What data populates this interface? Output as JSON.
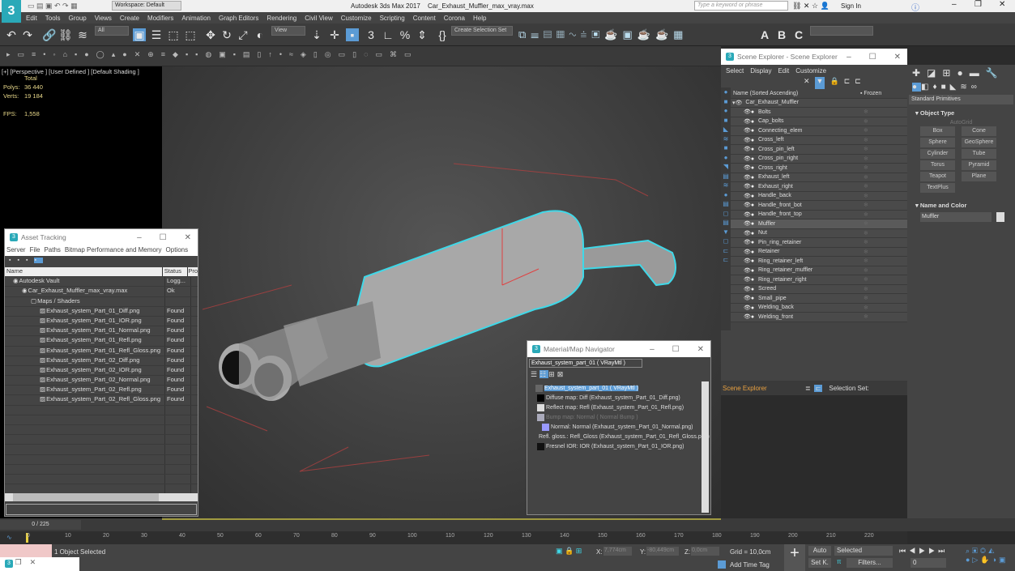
{
  "app": {
    "title": "Autodesk 3ds Max 2017",
    "file": "Car_Exhaust_Muffler_max_vray.max",
    "workspace": "Workspace: Default",
    "search_placeholder": "Type a keyword or phrase",
    "sign_in": "Sign In"
  },
  "menu": [
    "Edit",
    "Tools",
    "Group",
    "Views",
    "Create",
    "Modifiers",
    "Animation",
    "Graph Editors",
    "Rendering",
    "Civil View",
    "Customize",
    "Scripting",
    "Content",
    "Corona",
    "Help"
  ],
  "toolbar": {
    "filter": "All",
    "refcoord": "View",
    "selection_set": "Create Selection Set"
  },
  "viewport": {
    "label": "[+] [Perspective ] [User Defined ] [Default Shading ]",
    "stats_header": "Total",
    "polys_label": "Polys:",
    "polys": "36 440",
    "verts_label": "Verts:",
    "verts": "19 184",
    "fps_label": "FPS:",
    "fps": "1,558"
  },
  "scene_explorer": {
    "title": "Scene Explorer - Scene Explorer",
    "menu": [
      "Select",
      "Display",
      "Edit",
      "Customize"
    ],
    "col_name": "Name (Sorted Ascending)",
    "col_frozen": "▪ Frozen",
    "root": "Car_Exhaust_Muffler",
    "items": [
      "Bolts",
      "Cap_bolts",
      "Connecting_elem",
      "Cross_left",
      "Cross_pin_left",
      "Cross_pin_right",
      "Cross_right",
      "Exhaust_left",
      "Exhaust_right",
      "Handle_back",
      "Handle_front_bot",
      "Handle_front_top",
      "Muffler",
      "Nut",
      "Pin_ring_retainer",
      "Retainer",
      "Ring_retainer_left",
      "Ring_retainer_muffler",
      "Ring_retainer_right",
      "Screed",
      "Small_pipe",
      "Welding_back",
      "Welding_front"
    ],
    "selected": "Muffler",
    "footer": "Scene Explorer",
    "selection_set_label": "Selection Set:"
  },
  "command_panel": {
    "dropdown": "Standard Primitives",
    "object_type": "Object Type",
    "autogrid": "AutoGrid",
    "buttons": [
      "Box",
      "Cone",
      "Sphere",
      "GeoSphere",
      "Cylinder",
      "Tube",
      "Torus",
      "Pyramid",
      "Teapot",
      "Plane",
      "TextPlus"
    ],
    "name_color": "Name and Color",
    "object_name": "Muffler"
  },
  "asset_tracking": {
    "title": "Asset Tracking",
    "menu": [
      "Server",
      "File",
      "Paths",
      "Bitmap Performance and Memory",
      "Options"
    ],
    "col_name": "Name",
    "col_status": "Status",
    "col_pro": "Pro",
    "rows": [
      {
        "name": "Autodesk Vault",
        "status": "Logg...",
        "level": 0
      },
      {
        "name": "Car_Exhaust_Muffler_max_vray.max",
        "status": "Ok",
        "level": 1
      },
      {
        "name": "Maps / Shaders",
        "status": "",
        "level": 2
      },
      {
        "name": "Exhaust_system_Part_01_Diff.png",
        "status": "Found",
        "level": 3
      },
      {
        "name": "Exhaust_system_Part_01_IOR.png",
        "status": "Found",
        "level": 3
      },
      {
        "name": "Exhaust_system_Part_01_Normal.png",
        "status": "Found",
        "level": 3
      },
      {
        "name": "Exhaust_system_Part_01_Refl.png",
        "status": "Found",
        "level": 3
      },
      {
        "name": "Exhaust_system_Part_01_Refl_Gloss.png",
        "status": "Found",
        "level": 3
      },
      {
        "name": "Exhaust_system_Part_02_Diff.png",
        "status": "Found",
        "level": 3
      },
      {
        "name": "Exhaust_system_Part_02_IOR.png",
        "status": "Found",
        "level": 3
      },
      {
        "name": "Exhaust_system_Part_02_Normal.png",
        "status": "Found",
        "level": 3
      },
      {
        "name": "Exhaust_system_Part_02_Refl.png",
        "status": "Found",
        "level": 3
      },
      {
        "name": "Exhaust_system_Part_02_Refl_Gloss.png",
        "status": "Found",
        "level": 3
      }
    ]
  },
  "material_navigator": {
    "title": "Material/Map Navigator",
    "field": "Exhaust_system_part_01  ( VRayMtl )",
    "items": [
      {
        "text": "Exhaust_system_part_01  ( VRayMtl )",
        "swatch": "#666",
        "selected": true
      },
      {
        "text": "Diffuse map: Diff (Exhaust_system_Part_01_Diff.png)",
        "swatch": "#000"
      },
      {
        "text": "Reflect map: Refl (Exhaust_system_Part_01_Refl.png)",
        "swatch": "#ddd"
      },
      {
        "text": "Bump map: Normal  ( Normal Bump )",
        "swatch": "#aab",
        "dim": true
      },
      {
        "text": "Normal: Normal (Exhaust_system_Part_01_Normal.png)",
        "swatch": "#99f"
      },
      {
        "text": "Refl. gloss.: Refl_Gloss (Exhaust_system_Part_01_Refl_Gloss.png)",
        "swatch": "#eee"
      },
      {
        "text": "Fresnel IOR: IOR (Exhaust_system_Part_01_IOR.png)",
        "swatch": "#111"
      }
    ]
  },
  "timeline": {
    "frame": "0 / 225",
    "ticks": [
      "0",
      "10",
      "20",
      "30",
      "40",
      "50",
      "60",
      "70",
      "80",
      "90",
      "100",
      "110",
      "120",
      "130",
      "140",
      "150",
      "160",
      "170",
      "180",
      "190",
      "200",
      "210",
      "220"
    ]
  },
  "status": {
    "selected": "1 Object Selected",
    "x_label": "X:",
    "x": "7,774cm",
    "y_label": "Y:",
    "y": "-80,449cm",
    "z_label": "Z:",
    "z": "0,0cm",
    "grid": "Grid = 10,0cm",
    "add_time_tag": "Add Time Tag",
    "auto": "Auto",
    "set_key": "Set K.",
    "key_mode": "Selected",
    "filters": "Filters...",
    "frame_field": "0"
  },
  "colors": {
    "accent": "#5b9bd5",
    "selection": "#3fd8e8",
    "viewport_text": "#e8d88a"
  }
}
